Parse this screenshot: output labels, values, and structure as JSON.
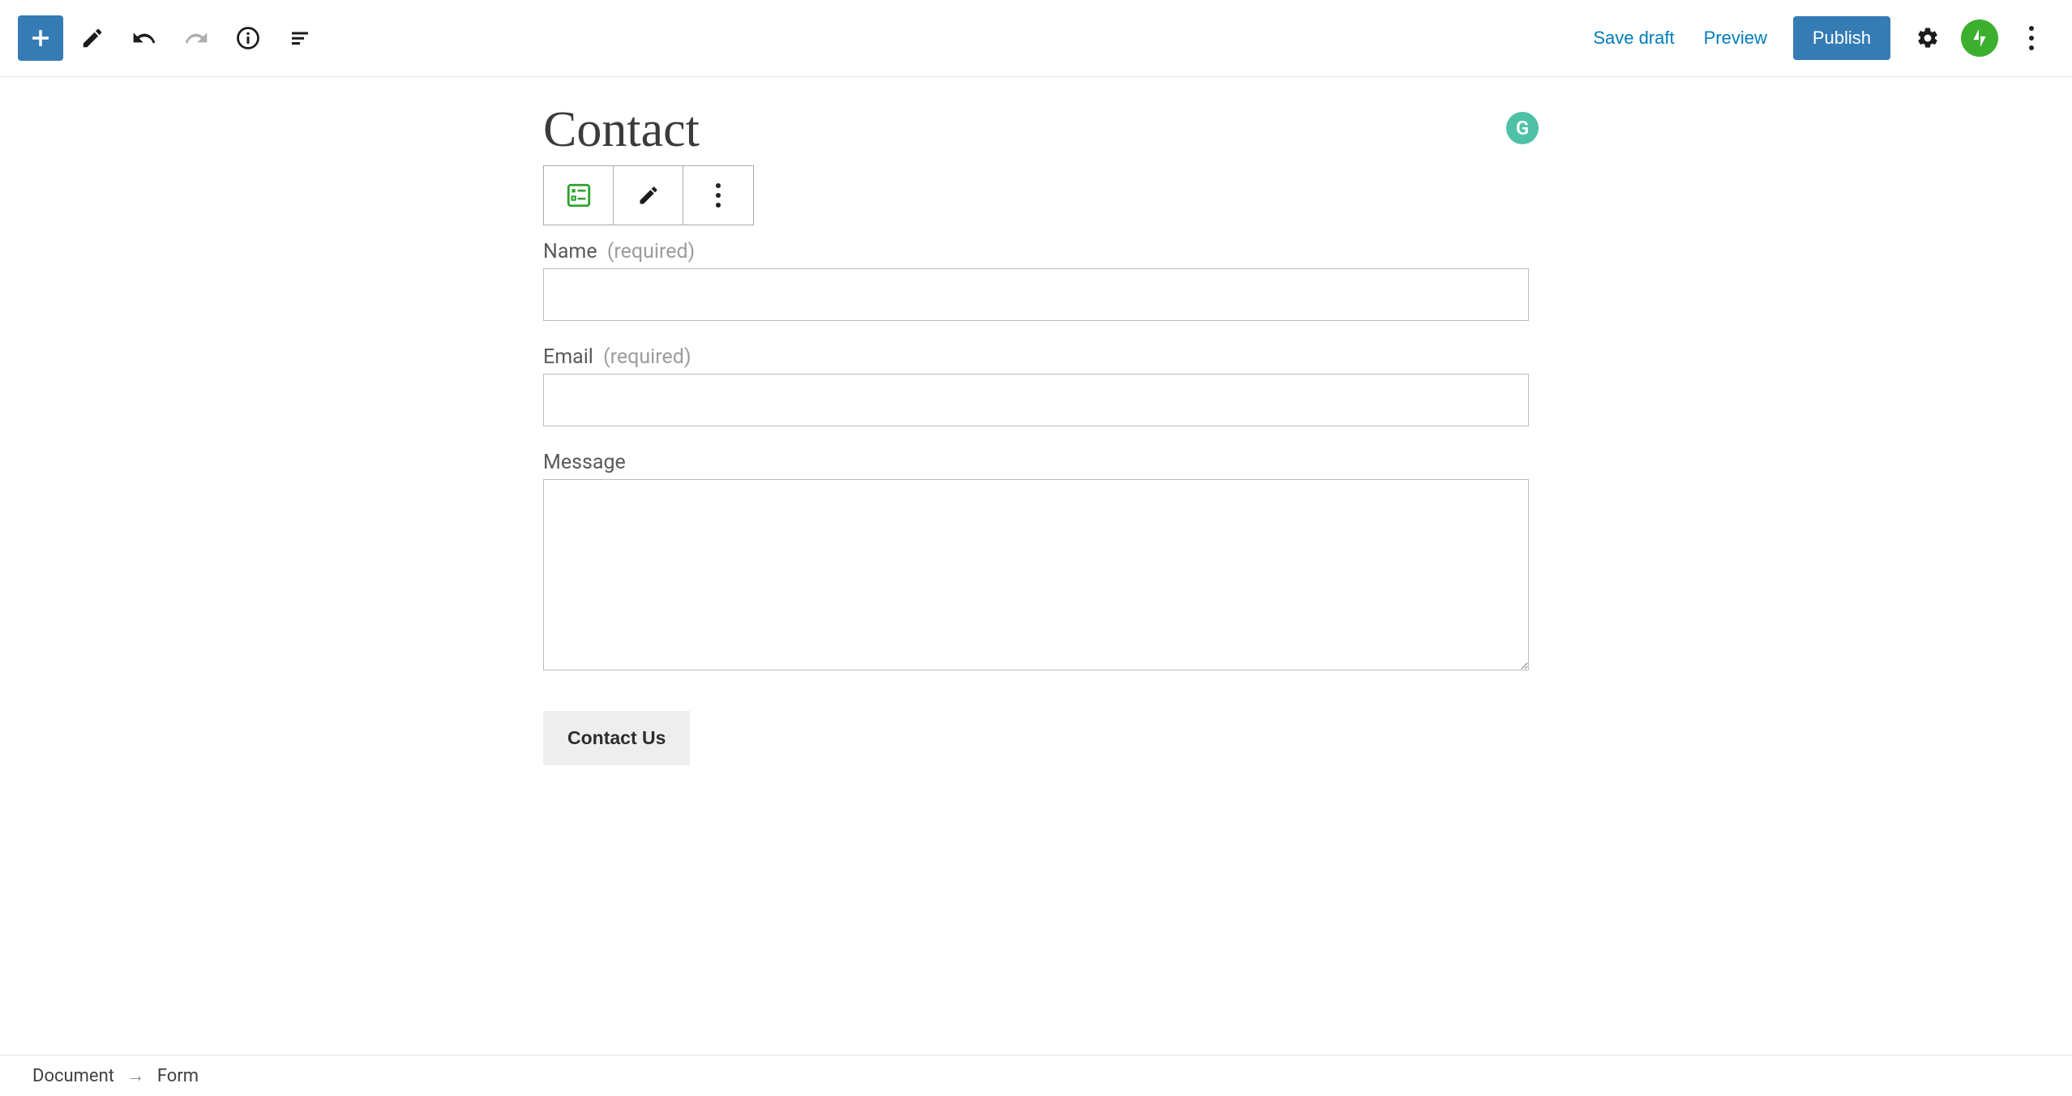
{
  "topbar": {
    "save_draft": "Save draft",
    "preview": "Preview",
    "publish": "Publish"
  },
  "page": {
    "title": "Contact"
  },
  "form_fields": [
    {
      "label": "Name",
      "required_text": "(required)",
      "type": "text",
      "value": ""
    },
    {
      "label": "Email",
      "required_text": "(required)",
      "type": "text",
      "value": ""
    },
    {
      "label": "Message",
      "required_text": "",
      "type": "textarea",
      "value": ""
    }
  ],
  "form": {
    "submit_label": "Contact Us"
  },
  "breadcrumb": {
    "root": "Document",
    "item": "Form"
  },
  "grammarly_letter": "G"
}
